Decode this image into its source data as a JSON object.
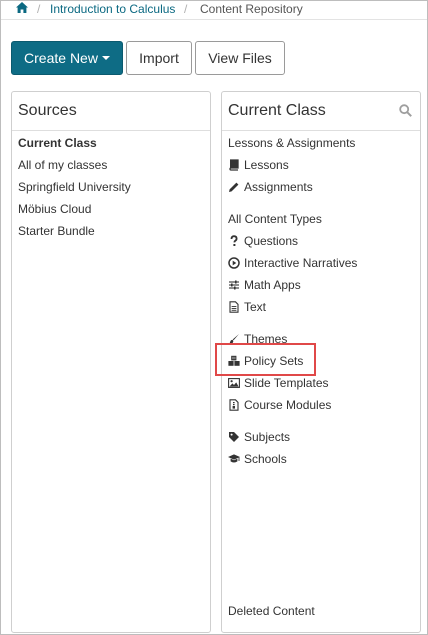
{
  "breadcrumb": {
    "course": "Introduction to Calculus",
    "current": "Content Repository",
    "separator": "/"
  },
  "toolbar": {
    "create_new": "Create New",
    "import": "Import",
    "view_files": "View Files"
  },
  "sources": {
    "title": "Sources",
    "items": [
      "Current Class",
      "All of my classes",
      "Springfield University",
      "Möbius Cloud",
      "Starter Bundle"
    ]
  },
  "current_class": {
    "title": "Current Class",
    "lessons_section": "Lessons & Assignments",
    "lessons": "Lessons",
    "assignments": "Assignments",
    "content_section": "All Content Types",
    "questions": "Questions",
    "interactive_narratives": "Interactive Narratives",
    "math_apps": "Math Apps",
    "text": "Text",
    "themes": "Themes",
    "policy_sets": "Policy Sets",
    "slide_templates": "Slide Templates",
    "course_modules": "Course Modules",
    "subjects": "Subjects",
    "schools": "Schools",
    "deleted_content": "Deleted Content"
  },
  "colors": {
    "accent": "#0e6c85",
    "link": "#0b6982",
    "highlight": "#e04848"
  }
}
